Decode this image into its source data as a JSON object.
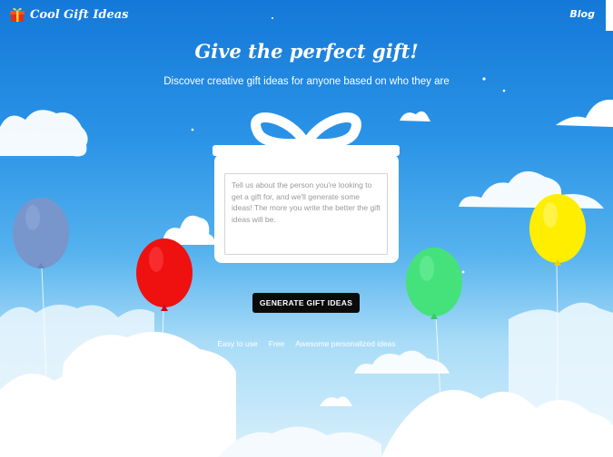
{
  "header": {
    "brand_name": "Cool Gift Ideas",
    "brand_icon": "gift-icon",
    "nav_blog": "Blog"
  },
  "hero": {
    "title": "Give the perfect gift!",
    "subtitle": "Discover creative gift ideas for anyone based on who they are"
  },
  "form": {
    "placeholder": "Tell us about the person you're looking to get a gift for, and we'll generate some ideas! The more you write the better the gift ideas will be.",
    "value": "",
    "submit_label": "GENERATE GIFT IDEAS"
  },
  "features": [
    "Easy to use",
    "Free",
    "Awesome personalized ideas"
  ],
  "colors": {
    "sky_top": "#1478d8",
    "sky_bottom": "#d9f0fb",
    "balloon_blue": "#7896cc",
    "balloon_red": "#ef1010",
    "balloon_green": "#45e27c",
    "balloon_yellow": "#ffee00",
    "button": "#0b0b0b"
  }
}
